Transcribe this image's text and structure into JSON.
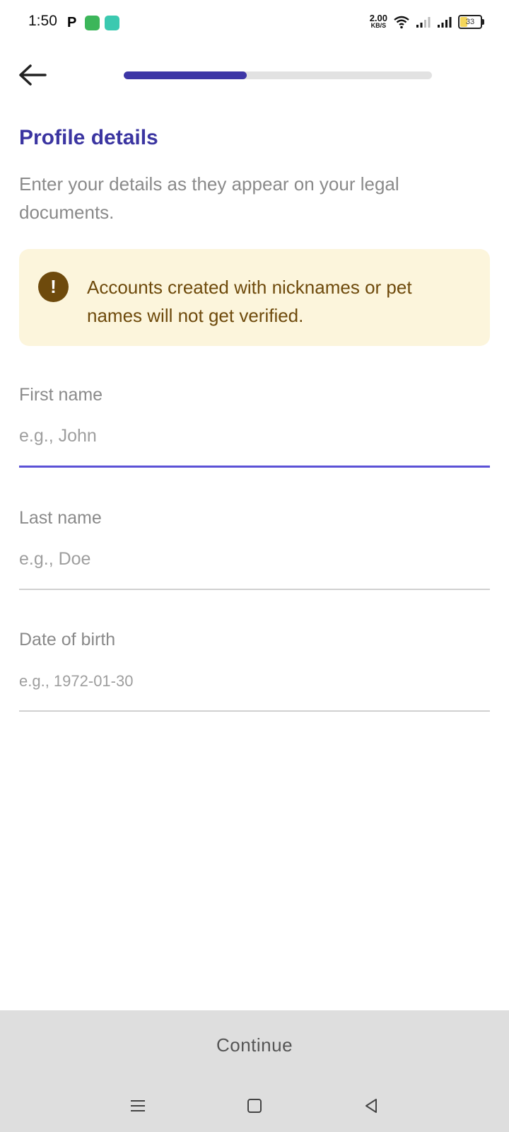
{
  "status_bar": {
    "time": "1:50",
    "net_speed": "2.00",
    "net_unit": "KB/S",
    "battery": "33"
  },
  "header": {
    "progress_fraction": 0.4
  },
  "page": {
    "title": "Profile details",
    "subtitle": "Enter your details as they appear on your legal documents.",
    "warning": "Accounts created with nicknames or pet names will not get verified."
  },
  "form": {
    "first_name_label": "First name",
    "first_name_placeholder": "e.g., John",
    "last_name_label": "Last name",
    "last_name_placeholder": "e.g., Doe",
    "dob_label": "Date of birth",
    "dob_placeholder": "e.g., 1972-01-30"
  },
  "footer": {
    "continue_label": "Continue"
  },
  "colors": {
    "accent": "#3b35a1",
    "progress_fill": "#3d36a6",
    "warning_bg": "#fcf5dc",
    "warning_text": "#6e4a0c",
    "active_underline": "#5b51d6"
  }
}
